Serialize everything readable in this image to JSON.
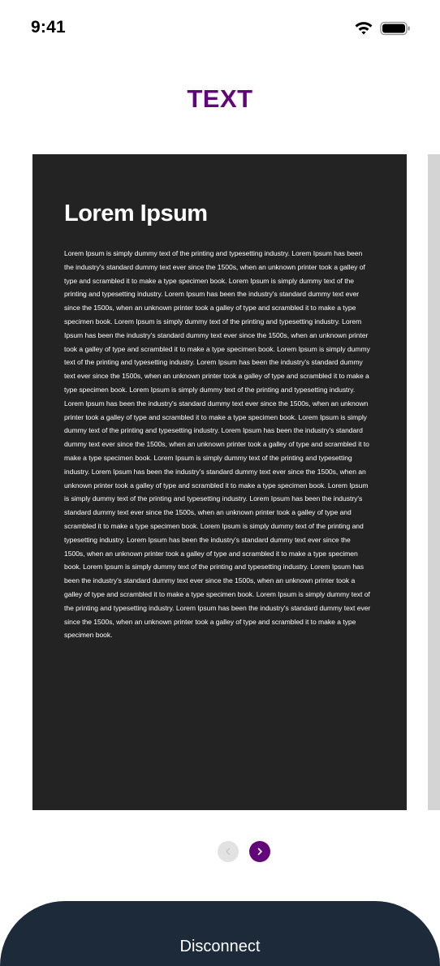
{
  "status_bar": {
    "time": "9:41",
    "icons": [
      "wifi-icon",
      "battery-icon"
    ]
  },
  "header": {
    "title": "TEXT",
    "title_color": "#62047a"
  },
  "card": {
    "heading": "Lorem Ipsum",
    "body": "Lorem Ipsum is simply dummy text of the printing and typesetting industry. Lorem Ipsum has been the industry's standard dummy text ever since the 1500s, when an unknown printer took a galley of type and scrambled it to make a type specimen book. Lorem Ipsum is simply dummy text of the printing and typesetting industry. Lorem Ipsum has been the industry's standard dummy text ever since the 1500s, when an unknown printer took a galley of type and scrambled it to make a type specimen book. Lorem Ipsum is simply dummy text of the printing and typesetting industry. Lorem Ipsum has been the industry's standard dummy text ever since the 1500s, when an unknown printer took a galley of type and scrambled it to make a type specimen book. Lorem Ipsum is simply dummy text of the printing and typesetting industry. Lorem Ipsum has been the industry's standard dummy text ever since the 1500s, when an unknown printer took a galley of type and scrambled it to make a type specimen book. Lorem Ipsum is simply dummy text of the printing and typesetting industry. Lorem Ipsum has been the industry's standard dummy text ever since the 1500s, when an unknown printer took a galley of type and scrambled it to make a type specimen book. Lorem Ipsum is simply dummy text of the printing and typesetting industry. Lorem Ipsum has been the industry's standard dummy text ever since the 1500s, when an unknown printer took a galley of type and scrambled it to make a type specimen book. Lorem Ipsum is simply dummy text of the printing and typesetting industry. Lorem Ipsum has been the industry's standard dummy text ever since the 1500s, when an unknown printer took a galley of type and scrambled it to make a type specimen book. Lorem Ipsum is simply dummy text of the printing and typesetting industry. Lorem Ipsum has been the industry's standard dummy text ever since the 1500s, when an unknown printer took a galley of type and scrambled it to make a type specimen book. Lorem Ipsum is simply dummy text of the printing and typesetting industry. Lorem Ipsum has been the industry's standard dummy text ever since the 1500s, when an unknown printer took a galley of type and scrambled it to make a type specimen book. Lorem Ipsum is simply dummy text of the printing and typesetting industry. Lorem Ipsum has been the industry's standard dummy text ever since the 1500s, when an unknown printer took a galley of type and scrambled it to make a type specimen book. Lorem Ipsum is simply dummy text of the printing and typesetting industry. Lorem Ipsum has been the industry's standard dummy text ever since the 1500s, when an unknown printer took a galley of type and scrambled it to make a type specimen book.",
    "background": "#232323"
  },
  "pager": {
    "prev_icon": "chevron-left-icon",
    "next_icon": "chevron-right-icon",
    "prev_enabled": false,
    "next_color": "#62047a"
  },
  "footer": {
    "disconnect_label": "Disconnect",
    "background": "#1c2a3a"
  }
}
